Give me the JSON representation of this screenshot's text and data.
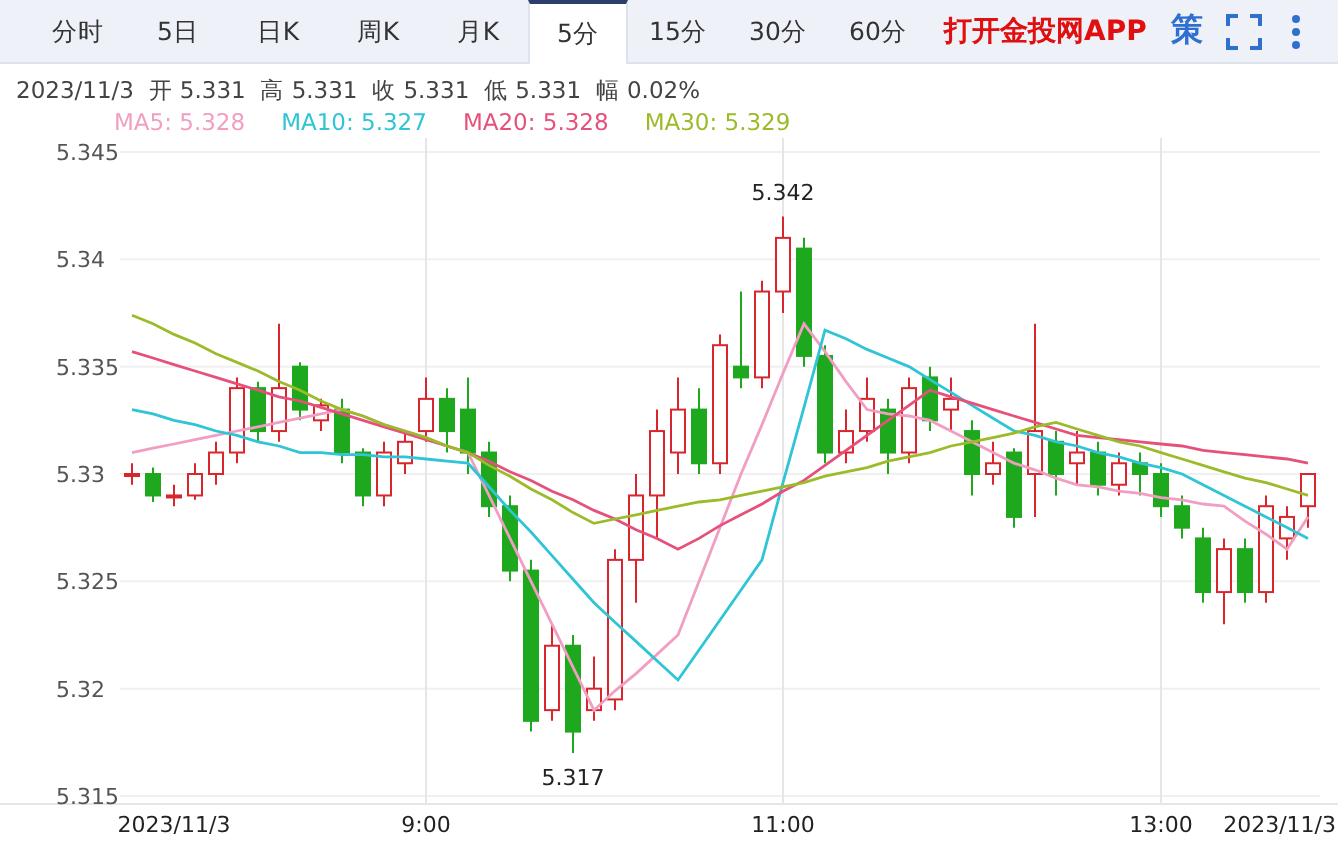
{
  "tabs": [
    {
      "label": "分时",
      "selected": false
    },
    {
      "label": "5日",
      "selected": false
    },
    {
      "label": "日K",
      "selected": false
    },
    {
      "label": "周K",
      "selected": false
    },
    {
      "label": "月K",
      "selected": false
    },
    {
      "label": "5分",
      "selected": true
    },
    {
      "label": "15分",
      "selected": false
    },
    {
      "label": "30分",
      "selected": false
    },
    {
      "label": "60分",
      "selected": false
    }
  ],
  "app_link": "打开金投网APP",
  "strategy_button": "策",
  "info_line": "2023/11/3  开 5.331  高 5.331  收 5.331  低 5.331  幅 0.02%",
  "ma_legend": [
    "5.328",
    "5.327",
    "5.328",
    "5.329"
  ],
  "chart_data": {
    "type": "candlestick",
    "grid": true,
    "ylim": [
      5.315,
      5.345
    ],
    "categories": [
      null,
      null,
      "2023/11/3",
      null,
      null,
      null,
      null,
      null,
      null,
      null,
      null,
      null,
      null,
      null,
      "9:00",
      null,
      null,
      null,
      null,
      null,
      null,
      null,
      null,
      null,
      null,
      null,
      null,
      null,
      null,
      null,
      null,
      "11:00",
      null,
      null,
      null,
      null,
      null,
      null,
      null,
      null,
      null,
      null,
      null,
      null,
      null,
      null,
      null,
      null,
      null,
      "13:00",
      null,
      null,
      null,
      null,
      null,
      "2023/11/3",
      null
    ],
    "yticks": [
      5.315,
      5.32,
      5.325,
      5.33,
      5.335,
      5.34,
      5.345
    ],
    "annotations": [
      {
        "text": "5.342",
        "y": 5.342
      },
      {
        "text": "5.317",
        "y": 5.317
      }
    ],
    "ohlc": [
      [
        5.33,
        5.3305,
        5.3295,
        5.33
      ],
      [
        5.33,
        5.3303,
        5.3287,
        5.329
      ],
      [
        5.329,
        5.3295,
        5.3285,
        5.329
      ],
      [
        5.329,
        5.3305,
        5.3288,
        5.33
      ],
      [
        5.33,
        5.3315,
        5.3295,
        5.331
      ],
      [
        5.331,
        5.3345,
        5.3305,
        5.334
      ],
      [
        5.334,
        5.3343,
        5.3315,
        5.332
      ],
      [
        5.332,
        5.337,
        5.3315,
        5.334
      ],
      [
        5.335,
        5.3352,
        5.3325,
        5.333
      ],
      [
        5.3325,
        5.3335,
        5.332,
        5.3332
      ],
      [
        5.333,
        5.3335,
        5.3305,
        5.331
      ],
      [
        5.331,
        5.3312,
        5.3285,
        5.329
      ],
      [
        5.329,
        5.3315,
        5.3285,
        5.331
      ],
      [
        5.3305,
        5.332,
        5.33,
        5.3315
      ],
      [
        5.332,
        5.3345,
        5.3315,
        5.3335
      ],
      [
        5.3335,
        5.334,
        5.331,
        5.332
      ],
      [
        5.333,
        5.3345,
        5.33,
        5.331
      ],
      [
        5.331,
        5.3315,
        5.328,
        5.3285
      ],
      [
        5.3285,
        5.329,
        5.325,
        5.3255
      ],
      [
        5.3255,
        5.326,
        5.318,
        5.3185
      ],
      [
        5.319,
        5.323,
        5.3185,
        5.322
      ],
      [
        5.322,
        5.3225,
        5.317,
        5.318
      ],
      [
        5.319,
        5.3215,
        5.3185,
        5.32
      ],
      [
        5.3195,
        5.3265,
        5.319,
        5.326
      ],
      [
        5.326,
        5.33,
        5.324,
        5.329
      ],
      [
        5.329,
        5.333,
        5.327,
        5.332
      ],
      [
        5.331,
        5.3345,
        5.33,
        5.333
      ],
      [
        5.333,
        5.334,
        5.33,
        5.3305
      ],
      [
        5.3305,
        5.3365,
        5.33,
        5.336
      ],
      [
        5.335,
        5.3385,
        5.334,
        5.3345
      ],
      [
        5.3345,
        5.339,
        5.334,
        5.3385
      ],
      [
        5.3385,
        5.342,
        5.3375,
        5.341
      ],
      [
        5.3405,
        5.341,
        5.335,
        5.3355
      ],
      [
        5.3355,
        5.336,
        5.3305,
        5.331
      ],
      [
        5.331,
        5.333,
        5.3305,
        5.332
      ],
      [
        5.332,
        5.3345,
        5.3315,
        5.3335
      ],
      [
        5.333,
        5.3335,
        5.33,
        5.331
      ],
      [
        5.331,
        5.3345,
        5.3305,
        5.334
      ],
      [
        5.3345,
        5.335,
        5.332,
        5.3325
      ],
      [
        5.333,
        5.3345,
        5.332,
        5.3335
      ],
      [
        5.332,
        5.3325,
        5.329,
        5.33
      ],
      [
        5.33,
        5.3315,
        5.3295,
        5.3305
      ],
      [
        5.331,
        5.3312,
        5.3275,
        5.328
      ],
      [
        5.33,
        5.337,
        5.328,
        5.332
      ],
      [
        5.3315,
        5.332,
        5.329,
        5.33
      ],
      [
        5.3305,
        5.332,
        5.3295,
        5.331
      ],
      [
        5.331,
        5.3315,
        5.329,
        5.3295
      ],
      [
        5.3295,
        5.331,
        5.329,
        5.3305
      ],
      [
        5.3305,
        5.331,
        5.329,
        5.33
      ],
      [
        5.33,
        5.3305,
        5.328,
        5.3285
      ],
      [
        5.3285,
        5.329,
        5.327,
        5.3275
      ],
      [
        5.327,
        5.3275,
        5.324,
        5.3245
      ],
      [
        5.3245,
        5.327,
        5.323,
        5.3265
      ],
      [
        5.3265,
        5.327,
        5.324,
        5.3245
      ],
      [
        5.3245,
        5.329,
        5.324,
        5.3285
      ],
      [
        5.327,
        5.3285,
        5.326,
        5.328
      ],
      [
        5.3285,
        5.33,
        5.3275,
        5.33
      ]
    ],
    "series": [
      {
        "name": "MA5:",
        "type": "line",
        "color": "#f19ec2",
        "values": [
          5.331,
          5.3312,
          5.3314,
          5.3316,
          5.3318,
          5.332,
          5.3322,
          5.3324,
          5.3326,
          5.3328,
          5.333,
          5.3327,
          5.3323,
          5.332,
          5.3317,
          5.3313,
          5.331,
          5.329,
          5.327,
          5.325,
          5.323,
          5.321,
          5.319,
          5.3199,
          5.3207,
          5.3216,
          5.3225,
          5.325,
          5.3275,
          5.33,
          5.3323,
          5.3347,
          5.337,
          5.3357,
          5.3343,
          5.333,
          5.3328,
          5.3327,
          5.3325,
          5.332,
          5.3315,
          5.331,
          5.3305,
          5.3302,
          5.3298,
          5.3295,
          5.3294,
          5.3292,
          5.3291,
          5.3289,
          5.3288,
          5.3286,
          5.3285,
          5.3278,
          5.3272,
          5.3265,
          5.328
        ]
      },
      {
        "name": "MA10:",
        "type": "line",
        "color": "#2fc4d6",
        "values": [
          5.333,
          5.3328,
          5.3325,
          5.3323,
          5.332,
          5.3318,
          5.3315,
          5.3313,
          5.331,
          5.331,
          5.3309,
          5.3309,
          5.3308,
          5.3308,
          5.3307,
          5.3306,
          5.3305,
          5.3294,
          5.3283,
          5.3273,
          5.3262,
          5.3251,
          5.324,
          5.3231,
          5.3222,
          5.3213,
          5.3204,
          5.3218,
          5.3232,
          5.3246,
          5.326,
          5.3296,
          5.3331,
          5.3367,
          5.3363,
          5.3358,
          5.3354,
          5.335,
          5.3344,
          5.3338,
          5.3332,
          5.3326,
          5.332,
          5.3318,
          5.3315,
          5.3313,
          5.331,
          5.3308,
          5.3305,
          5.3303,
          5.33,
          5.3295,
          5.329,
          5.3285,
          5.328,
          5.3275,
          5.327
        ]
      },
      {
        "name": "MA20:",
        "type": "line",
        "color": "#e5517a",
        "values": [
          5.3357,
          5.3354,
          5.3351,
          5.3348,
          5.3345,
          5.3342,
          5.3339,
          5.3336,
          5.3334,
          5.3331,
          5.3328,
          5.3325,
          5.3322,
          5.3319,
          5.3316,
          5.3313,
          5.331,
          5.3306,
          5.3301,
          5.3297,
          5.3292,
          5.3288,
          5.3283,
          5.3279,
          5.3274,
          5.327,
          5.3265,
          5.327,
          5.3276,
          5.3281,
          5.3286,
          5.3292,
          5.3297,
          5.3304,
          5.3311,
          5.3318,
          5.3325,
          5.3332,
          5.3339,
          5.3336,
          5.3333,
          5.333,
          5.3327,
          5.3324,
          5.3321,
          5.3318,
          5.3317,
          5.3316,
          5.3315,
          5.3314,
          5.3313,
          5.3311,
          5.331,
          5.3309,
          5.3308,
          5.3307,
          5.3305
        ]
      },
      {
        "name": "MA30:",
        "type": "line",
        "color": "#9cbb2a",
        "values": [
          5.3374,
          5.337,
          5.3365,
          5.3361,
          5.3356,
          5.3352,
          5.3348,
          5.3343,
          5.3339,
          5.3334,
          5.333,
          5.3327,
          5.3323,
          5.332,
          5.3317,
          5.3313,
          5.331,
          5.3304,
          5.3299,
          5.3293,
          5.3288,
          5.3282,
          5.3277,
          5.3279,
          5.3281,
          5.3283,
          5.3285,
          5.3287,
          5.3288,
          5.329,
          5.3292,
          5.3294,
          5.3296,
          5.3299,
          5.3301,
          5.3303,
          5.3306,
          5.3308,
          5.331,
          5.3313,
          5.3315,
          5.3317,
          5.3319,
          5.3322,
          5.3324,
          5.3321,
          5.3318,
          5.3315,
          5.3313,
          5.331,
          5.3307,
          5.3304,
          5.3301,
          5.3298,
          5.3296,
          5.3293,
          5.329
        ]
      }
    ]
  }
}
